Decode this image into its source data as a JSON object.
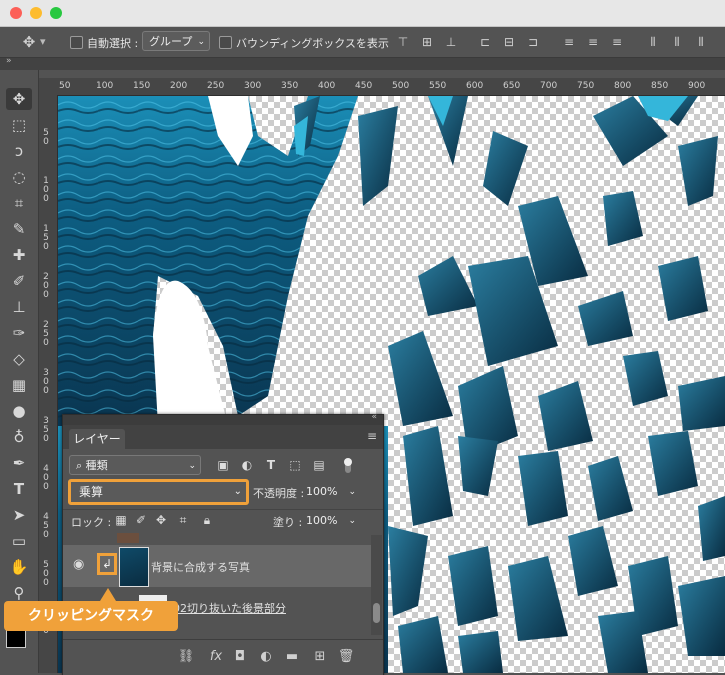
{
  "window": {
    "buttons": {
      "close": "#fc5f57",
      "minimize": "#fdbc2e",
      "maximize": "#28c840"
    }
  },
  "options_bar": {
    "auto_select_label": "自動選択 :",
    "auto_select_value": "グループ",
    "bounding_box_label": "バウンディングボックスを表示"
  },
  "rulers": {
    "horizontal": [
      "50",
      "100",
      "150",
      "200",
      "250",
      "300",
      "350",
      "400",
      "450",
      "500",
      "550",
      "600",
      "650",
      "700",
      "750",
      "800",
      "850",
      "900"
    ],
    "vertical": [
      "5\n0",
      "1\n0\n0",
      "1\n5\n0",
      "2\n0\n0",
      "2\n5\n0",
      "3\n0\n0",
      "3\n5\n0",
      "4\n0\n0",
      "4\n5\n0",
      "5\n0\n0",
      "5\n5\n0"
    ]
  },
  "layers_panel": {
    "tab_label": "レイヤー",
    "filter_label": "種類",
    "blend_mode": "乗算",
    "opacity_label": "不透明度 :",
    "opacity_value": "100%",
    "lock_label": "ロック :",
    "fill_label": "塗り :",
    "fill_value": "100%",
    "layers": [
      {
        "name": "背景に合成する写真",
        "clipped": true,
        "visible": true
      },
      {
        "name": "02切り抜いた後景部分",
        "clipped": false,
        "visible": true
      }
    ]
  },
  "callout": {
    "text": "クリッピングマスク",
    "color": "#f0a13a"
  },
  "colors": {
    "ui_bg": "#535353",
    "accent_orange": "#f0a13a",
    "water_dark": "#0c3a56",
    "water_light": "#2fb4d6"
  }
}
